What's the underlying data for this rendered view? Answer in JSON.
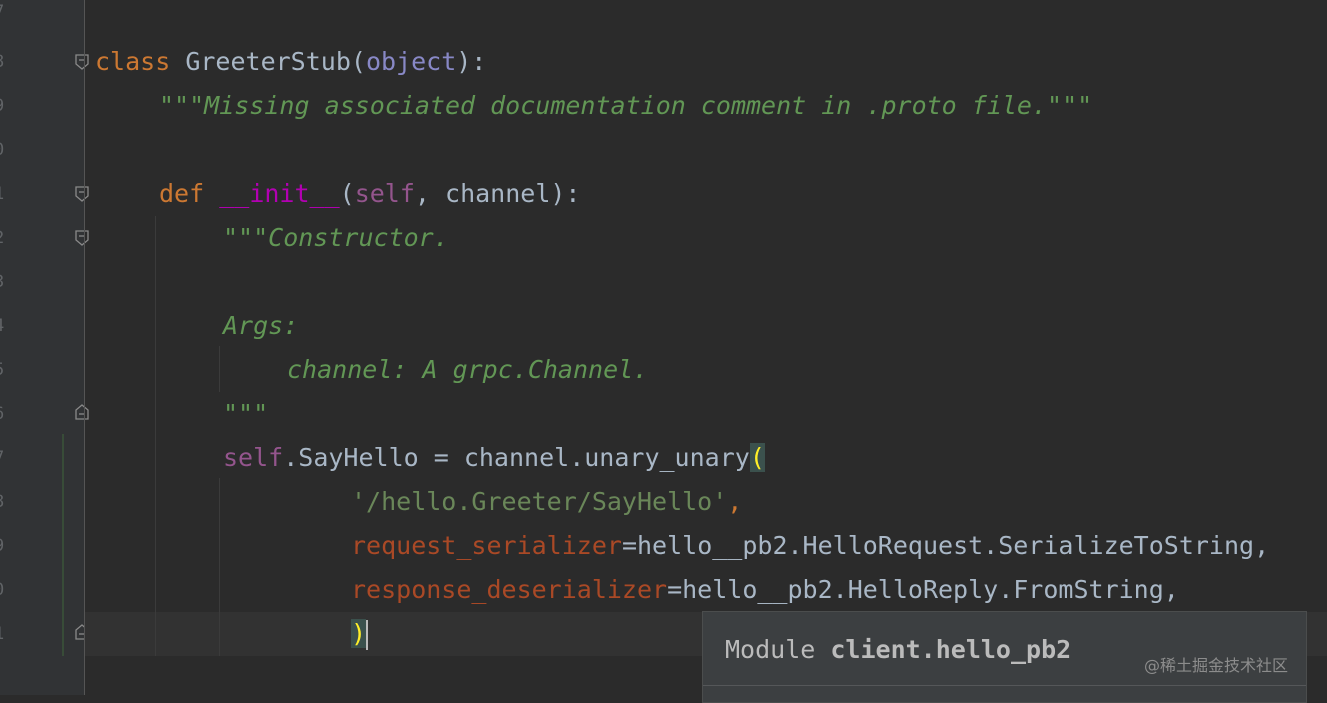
{
  "gutter": {
    "line_numbers": [
      "7",
      "8",
      "9",
      "0",
      "1",
      "2",
      "3",
      "4",
      "5",
      "6",
      "7",
      "8",
      "9",
      "0",
      "1"
    ]
  },
  "code": {
    "line1": {
      "kw": "class",
      "name": " GreeterStub(",
      "base": "object",
      "tail": "):"
    },
    "line2": {
      "doc": "\"\"\"Missing associated documentation comment in .proto file.\"\"\""
    },
    "line3": {
      "kw": "def",
      "sp": " ",
      "magic": "__init__",
      "open": "(",
      "self": "self",
      "rest": ", channel):"
    },
    "line4": {
      "doc": "\"\"\"Constructor."
    },
    "line5": {
      "doc": "Args:"
    },
    "line6": {
      "doc": "channel: A grpc.Channel."
    },
    "line7": {
      "doc": "\"\"\""
    },
    "line8": {
      "self": "self",
      "rest": ".SayHello = channel.unary_unary",
      "bracket": "("
    },
    "line9": {
      "str": "'/hello.Greeter/SayHello'",
      "comma": ","
    },
    "line10": {
      "param": "request_serializer",
      "rest": "=hello__pb2.HelloRequest.SerializeToString,"
    },
    "line11": {
      "param": "response_deserializer",
      "rest": "=hello__pb2.HelloReply.FromString,"
    },
    "line12": {
      "bracket": ")"
    }
  },
  "popup": {
    "prefix": "Module ",
    "module": "client.hello_pb2"
  },
  "watermark": "@稀土掘金技术社区",
  "colors": {
    "keyword": "#cc7832",
    "docstring": "#629755",
    "string": "#6a8759",
    "param": "#aa4926",
    "self": "#94558d",
    "magic": "#b200b2",
    "builtin": "#8888c6",
    "text": "#a9b7c6",
    "background": "#2b2b2b"
  }
}
